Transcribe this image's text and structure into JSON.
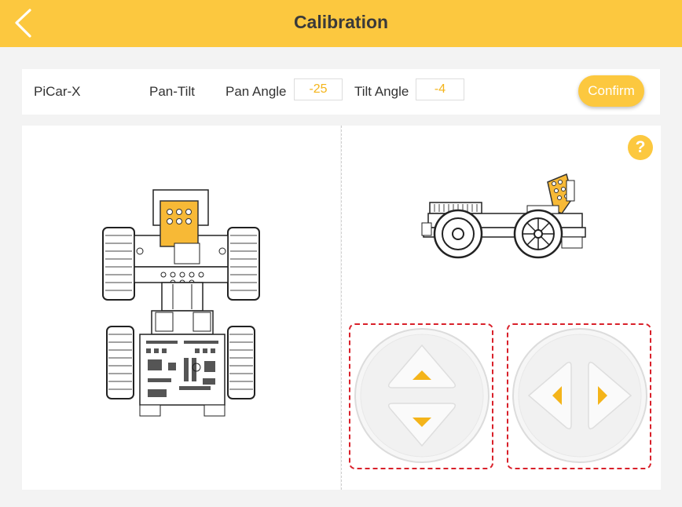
{
  "header": {
    "title": "Calibration",
    "back_icon": "chevron-left-icon"
  },
  "settings": {
    "model": "PiCar-X",
    "part": "Pan-Tilt",
    "pan_label": "Pan Angle",
    "pan_value": "-25",
    "tilt_label": "Tilt Angle",
    "tilt_value": "-4",
    "confirm_label": "Confirm"
  },
  "help": {
    "label": "?",
    "icon": "help-icon"
  },
  "controls": {
    "tilt_pad": {
      "icons": [
        "arrow-up-icon",
        "arrow-down-icon"
      ]
    },
    "pan_pad": {
      "icons": [
        "arrow-left-icon",
        "arrow-right-icon"
      ]
    }
  },
  "colors": {
    "accent": "#fcc83f",
    "value_text": "#f4b41a",
    "control_border": "#d9202a",
    "background": "#f3f3f3"
  }
}
